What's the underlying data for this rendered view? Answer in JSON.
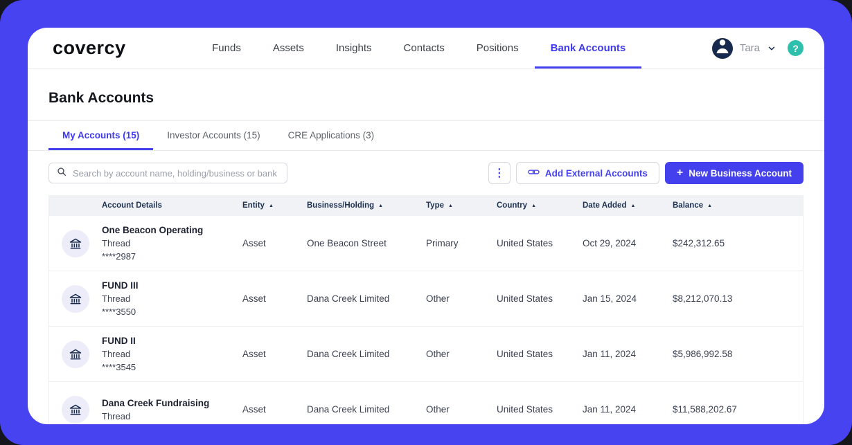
{
  "nav": {
    "logo": "covercy",
    "items": [
      {
        "label": "Funds"
      },
      {
        "label": "Assets"
      },
      {
        "label": "Insights"
      },
      {
        "label": "Contacts"
      },
      {
        "label": "Positions"
      },
      {
        "label": "Bank Accounts"
      }
    ],
    "user": "Tara"
  },
  "icons": {
    "help": "?",
    "kebab": "⋮",
    "plus": "+",
    "sort_asc": "▲"
  },
  "page": {
    "title": "Bank Accounts"
  },
  "tabs": [
    {
      "label": "My Accounts (15)"
    },
    {
      "label": "Investor Accounts (15)"
    },
    {
      "label": "CRE Applications (3)"
    }
  ],
  "toolbar": {
    "search_placeholder": "Search by account name, holding/business or bank",
    "add_external_label": "Add External Accounts",
    "new_business_label": "New Business Account"
  },
  "table": {
    "columns": [
      {
        "label": "Account Details"
      },
      {
        "label": "Entity"
      },
      {
        "label": "Business/Holding"
      },
      {
        "label": "Type"
      },
      {
        "label": "Country"
      },
      {
        "label": "Date Added"
      },
      {
        "label": "Balance"
      }
    ],
    "rows": [
      {
        "name": "One Beacon Operating",
        "bank": "Thread",
        "number": "****2987",
        "entity": "Asset",
        "business": "One Beacon Street",
        "type": "Primary",
        "country": "United States",
        "date_added": "Oct 29, 2024",
        "balance": "$242,312.65"
      },
      {
        "name": "FUND III",
        "bank": "Thread",
        "number": "****3550",
        "entity": "Asset",
        "business": "Dana Creek Limited",
        "type": "Other",
        "country": "United States",
        "date_added": "Jan 15, 2024",
        "balance": "$8,212,070.13"
      },
      {
        "name": "FUND II",
        "bank": "Thread",
        "number": "****3545",
        "entity": "Asset",
        "business": "Dana Creek Limited",
        "type": "Other",
        "country": "United States",
        "date_added": "Jan 11, 2024",
        "balance": "$5,986,992.58"
      },
      {
        "name": "Dana Creek Fundraising",
        "bank": "Thread",
        "number": "",
        "entity": "Asset",
        "business": "Dana Creek Limited",
        "type": "Other",
        "country": "United States",
        "date_added": "Jan 11, 2024",
        "balance": "$11,588,202.67"
      }
    ]
  },
  "colors": {
    "accent": "#4440ee",
    "frame": "#4843f0",
    "help_teal": "#2ec0ad",
    "avatar_navy": "#17294d"
  }
}
